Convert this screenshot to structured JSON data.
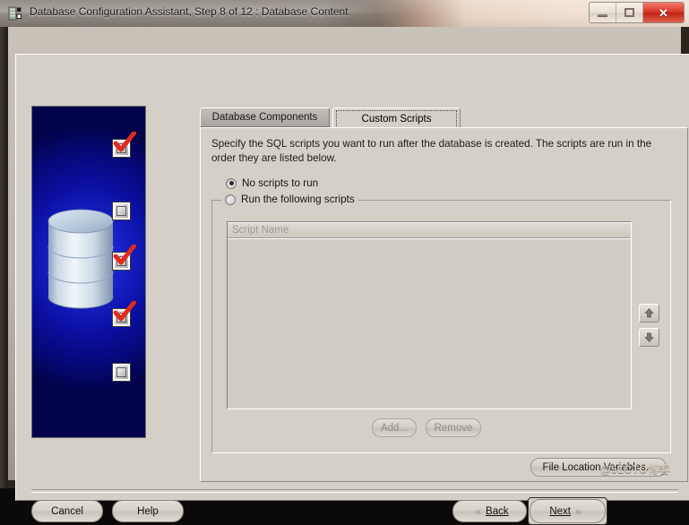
{
  "window": {
    "title": "Database Configuration Assistant, Step 8 of 12 : Database Content",
    "icon": "database-app-icon",
    "controls": {
      "minimize": "minimize-icon",
      "maximize": "maximize-icon",
      "close": "✕"
    }
  },
  "sidebar": {
    "illustration": "database-cylinder-illustration",
    "steps": [
      {
        "state": "checked"
      },
      {
        "state": "unchecked"
      },
      {
        "state": "checked"
      },
      {
        "state": "checked"
      },
      {
        "state": "unchecked"
      }
    ]
  },
  "tabs": [
    {
      "label": "Database Components",
      "active": false
    },
    {
      "label": "Custom Scripts",
      "active": true
    }
  ],
  "main": {
    "description": "Specify the SQL scripts you want to run after the database is created. The scripts are run in the order they are listed below.",
    "radio_no_scripts": "No scripts to run",
    "radio_run_scripts": "Run the following scripts",
    "table": {
      "columns": [
        "Script Name"
      ],
      "rows": []
    },
    "add_button": "Add...",
    "remove_button": "Remove",
    "move_up_icon": "arrow-up-icon",
    "move_down_icon": "arrow-down-icon",
    "file_location_button": "File Location Variables..."
  },
  "footer": {
    "cancel": "Cancel",
    "help": "Help",
    "back": "Back",
    "next": "Next",
    "back_arrow": "«",
    "next_arrow": "»"
  },
  "watermark": "@51CTO博客",
  "colors": {
    "dialog_face": "#d4d0c8",
    "frame": "#2a241d",
    "panel_blue": "#1722c9",
    "close_red": "#d9382a",
    "check_red": "#e02b1c"
  }
}
